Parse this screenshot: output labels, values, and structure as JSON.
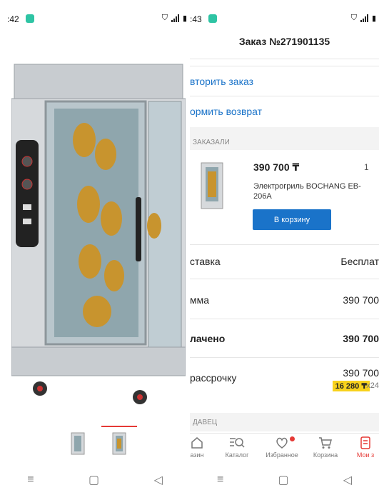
{
  "left": {
    "status": {
      "time": ":42"
    },
    "gallery": {
      "thumbnail_count": 2,
      "active_index": 1
    }
  },
  "right": {
    "status": {
      "time": ":43"
    },
    "header": {
      "title": "Заказ №271901135"
    },
    "actions": {
      "repeat_label": "вторить заказ",
      "return_label": "ормить возврат"
    },
    "ordered_section": {
      "label": "ЗАКАЗАЛИ"
    },
    "item": {
      "price": "390 700 ₸",
      "qty": "1",
      "name": "Электрогриль BOCHANG EB-206A",
      "cart_button": "В корзину"
    },
    "summary": {
      "delivery_label": "ставка",
      "delivery_value": "Бесплат",
      "sum_label": "мма",
      "sum_value": "390 700",
      "paid_label": "лачено",
      "paid_value": "390 700",
      "installment_label": "рассрочку",
      "installment_value": "390 700",
      "installment_monthly": "16 280 ₸",
      "installment_months": "x24"
    },
    "seller_section": {
      "label": "ДАВЕЦ"
    },
    "tabs": [
      {
        "label": "азин",
        "icon": "home-icon"
      },
      {
        "label": "Каталог",
        "icon": "catalog-search-icon"
      },
      {
        "label": "Избранное",
        "icon": "heart-icon"
      },
      {
        "label": "Корзина",
        "icon": "cart-icon"
      },
      {
        "label": "Мои з",
        "icon": "orders-icon"
      }
    ],
    "colors": {
      "accent_blue": "#1a73c9",
      "accent_red": "#e53935",
      "badge_yellow": "#f8d21c"
    }
  }
}
